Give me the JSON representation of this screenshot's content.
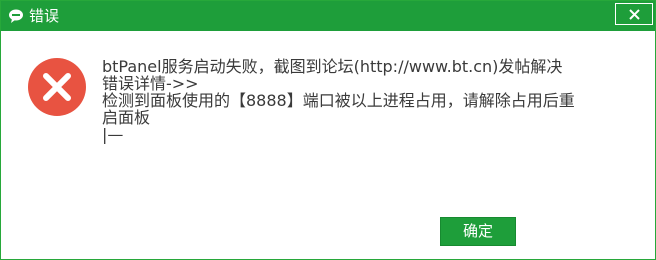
{
  "window": {
    "title": "错误",
    "close_glyph": "✕"
  },
  "message": {
    "lines": [
      "btPanel服务启动失败，截图到论坛(http://www.bt.cn)发帖解决",
      "错误详情->>",
      "检测到面板使用的【8888】端口被以上进程占用，请解除占用后重",
      "启面板",
      "|—"
    ]
  },
  "buttons": {
    "ok_label": "确定"
  },
  "icons": {
    "app": "chat-bubble-icon",
    "error": "error-x-icon",
    "close": "close-icon"
  },
  "colors": {
    "titlebar": "#1e9e3a",
    "error_red": "#e85341",
    "button_green": "#1e9e3a"
  }
}
